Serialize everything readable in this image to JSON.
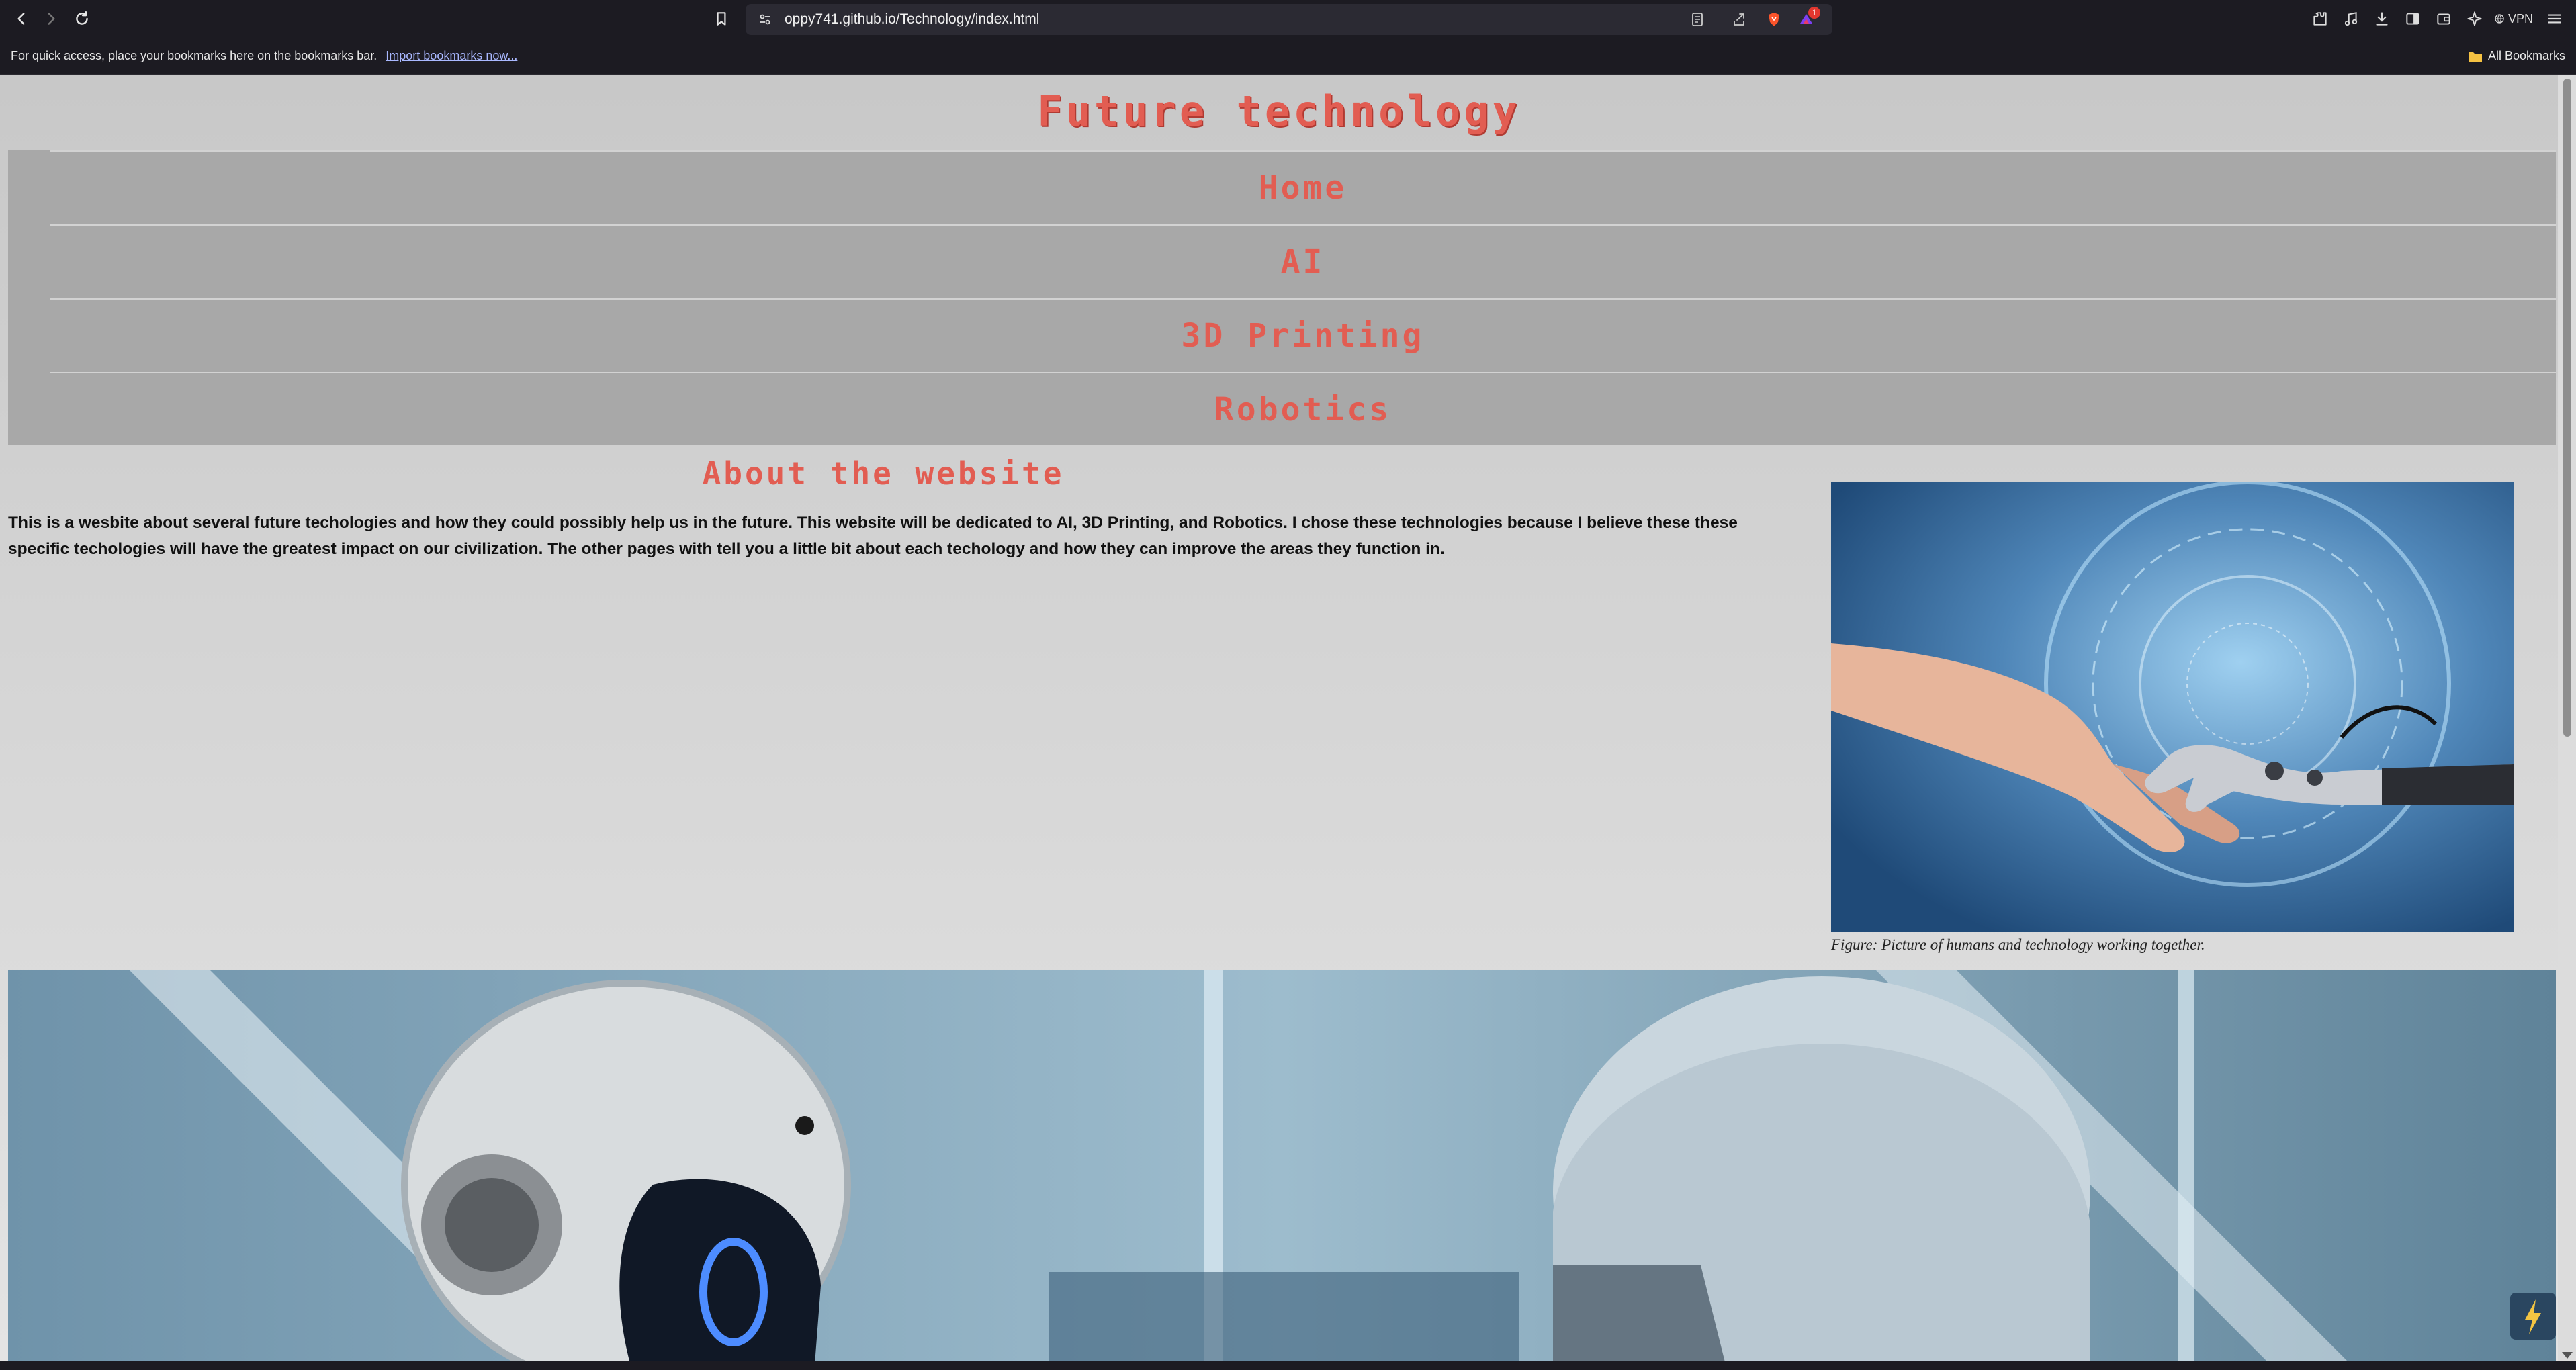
{
  "browser": {
    "url": "oppy741.github.io/Technology/index.html",
    "notification_count": "1",
    "vpn_label": "VPN"
  },
  "bookmarks_bar": {
    "hint": "For quick access, place your bookmarks here on the bookmarks bar.",
    "import_link": "Import bookmarks now...",
    "all_bookmarks": "All Bookmarks"
  },
  "page": {
    "title": "Future technology",
    "nav": [
      {
        "label": "Home"
      },
      {
        "label": "AI"
      },
      {
        "label": "3D Printing"
      },
      {
        "label": "Robotics"
      }
    ],
    "about_heading": "About the website",
    "about_text": "This is a wesbite about several future techologies and how they could possibly help us in the future. This website will be dedicated to AI, 3D Printing, and Robotics. I chose these technologies because I believe these these specific techologies will have the greatest impact on our civilization. The other pages with tell you a little bit about each techology and how they can improve the areas they function in.",
    "figure_caption": "Figure: Picture of humans and technology working together."
  },
  "colors": {
    "accent_red": "#e25d52",
    "nav_background": "#a8a8a8",
    "chrome_background": "#1c1b22"
  },
  "icons": [
    "back-icon",
    "forward-icon",
    "reload-icon",
    "bookmark-icon",
    "site-settings-icon",
    "reader-mode-icon",
    "share-icon",
    "brave-shields-icon",
    "brave-rewards-icon",
    "extensions-icon",
    "media-icon",
    "downloads-icon",
    "sidebar-icon",
    "wallet-icon",
    "leo-ai-icon",
    "menu-icon",
    "folder-icon"
  ]
}
